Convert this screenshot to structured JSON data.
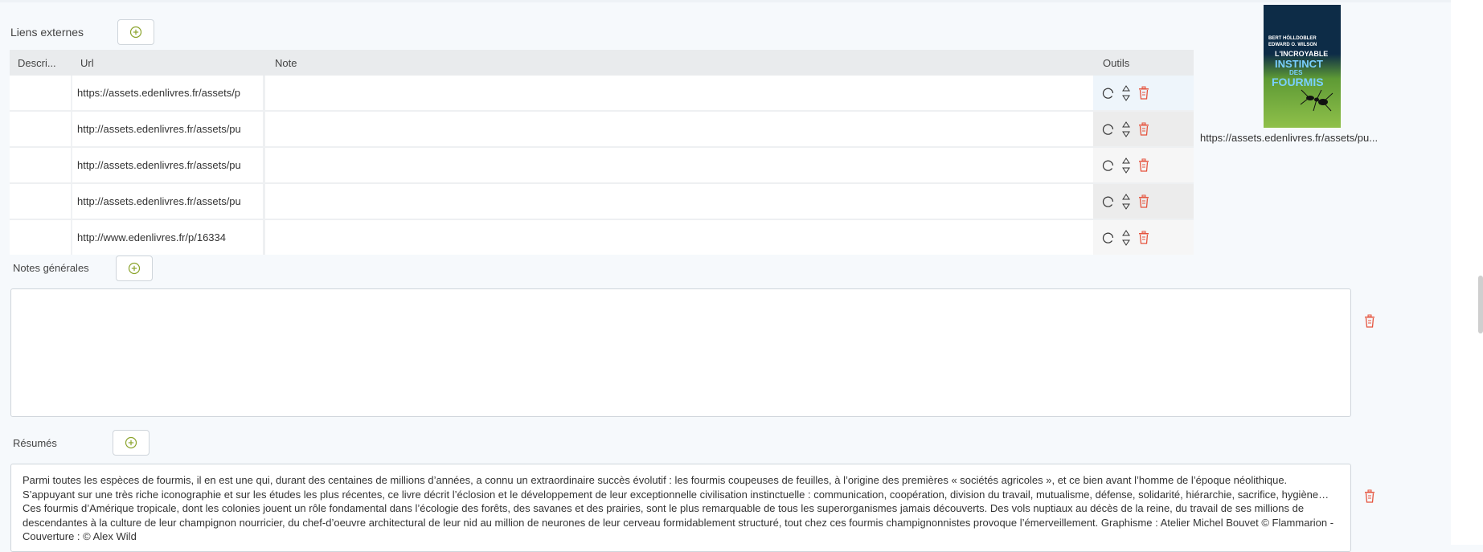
{
  "external_links": {
    "label": "Liens externes",
    "columns": [
      "Descri...",
      "Url",
      "Note",
      "Outils"
    ],
    "rows": [
      {
        "description": "",
        "url": "https://assets.edenlivres.fr/assets/p",
        "note": ""
      },
      {
        "description": "",
        "url": "http://assets.edenlivres.fr/assets/pu",
        "note": ""
      },
      {
        "description": "",
        "url": "http://assets.edenlivres.fr/assets/pu",
        "note": ""
      },
      {
        "description": "",
        "url": "http://assets.edenlivres.fr/assets/pu",
        "note": ""
      },
      {
        "description": "",
        "url": "http://www.edenlivres.fr/p/16334",
        "note": ""
      }
    ]
  },
  "cover": {
    "authors_line1": "BERT HÖLLDOBLER",
    "authors_line2": "EDWARD O. WILSON",
    "title_line1": "L'INCROYABLE",
    "title_line2": "INSTINCT",
    "title_line3": "DES",
    "title_line4": "FOURMIS",
    "caption": "https://assets.edenlivres.fr/assets/pu..."
  },
  "general_notes": {
    "label": "Notes générales",
    "value": ""
  },
  "summaries": {
    "label": "Résumés",
    "text": "Parmi toutes les espèces de fourmis, il en est une qui, durant des centaines de millions d’années, a connu un extraordinaire succès évolutif : les fourmis coupeuses de feuilles, à l’origine des premières « sociétés agricoles », et ce bien avant l’homme de l’époque néolithique. S’appuyant sur une très riche iconographie et sur les études les plus récentes, ce livre décrit l’éclosion et le développement de leur exceptionnelle civilisation instinctuelle : communication, coopération, division du travail, mutualisme, défense, solidarité, hiérarchie, sacrifice, hygiène… Ces fourmis d’Amérique tropicale, dont les colonies jouent un rôle fondamental dans l’écologie des forêts, des savanes et des prairies, sont le plus remarquable de tous les superorganismes jamais découverts. Des vols nuptiaux au décès de la reine, du travail de ses millions de descendantes à la culture de leur champignon nourricier, du chef-d’oeuvre architectural de leur nid au million de neurones de leur cerveau formidablement structuré, tout chez ces fourmis champignonnistes provoque l’émerveillement. Graphisme : Atelier Michel Bouvet © Flammarion - Couverture : © Alex Wild"
  },
  "colors": {
    "add_icon": "#8aa32a",
    "trash_icon": "#e5533d",
    "header_bg": "#e9ebed"
  },
  "icons": {
    "add": "plus-circle-icon",
    "edit": "circle-icon",
    "move": "up-down-chevron-icon",
    "delete": "trash-icon"
  }
}
